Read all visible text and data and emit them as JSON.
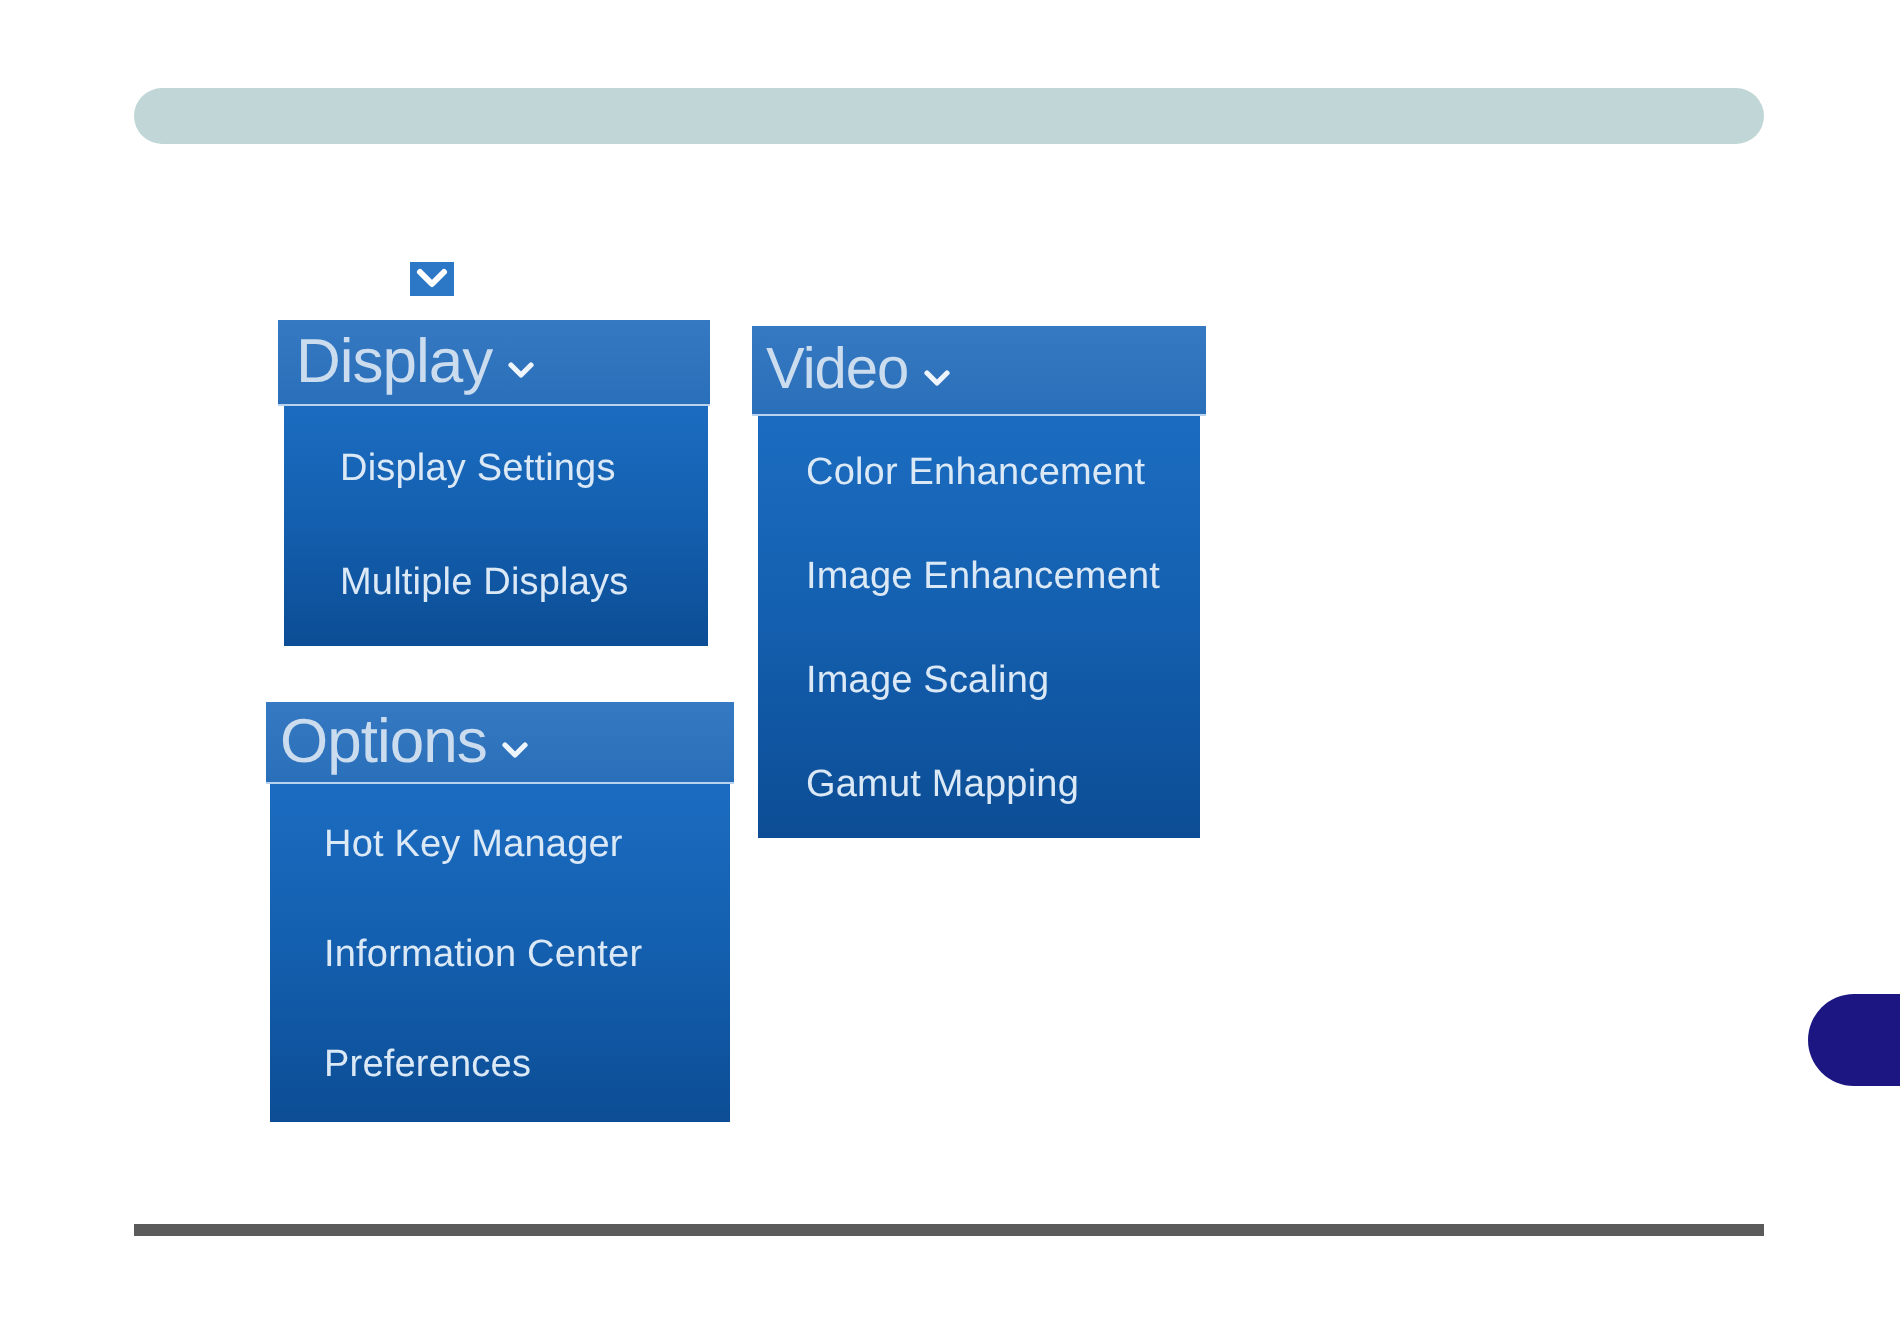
{
  "menus": [
    {
      "title": "Display",
      "items": [
        "Display Settings",
        "Multiple Displays"
      ]
    },
    {
      "title": "Video",
      "items": [
        "Color Enhancement",
        "Image Enhancement",
        "Image Scaling",
        "Gamut Mapping"
      ]
    },
    {
      "title": "Options",
      "items": [
        "Hot Key Manager",
        "Information Center",
        "Preferences"
      ]
    }
  ]
}
